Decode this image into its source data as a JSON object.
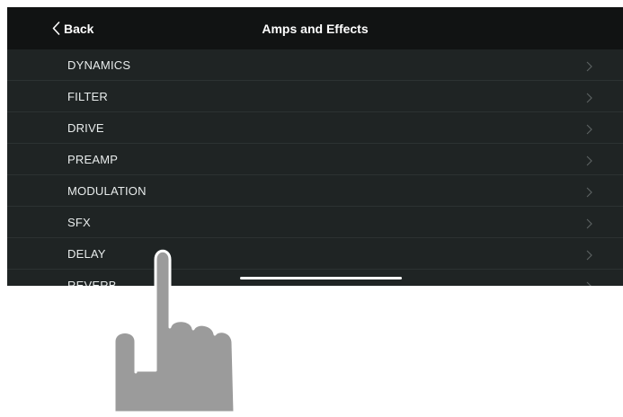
{
  "navbar": {
    "back_label": "Back",
    "title": "Amps and Effects"
  },
  "list": {
    "items": [
      {
        "label": "DYNAMICS"
      },
      {
        "label": "FILTER"
      },
      {
        "label": "DRIVE"
      },
      {
        "label": "PREAMP"
      },
      {
        "label": "MODULATION"
      },
      {
        "label": "SFX"
      },
      {
        "label": "DELAY"
      },
      {
        "label": "REVERB"
      }
    ]
  },
  "icons": {
    "back": "chevron-left-icon",
    "row": "chevron-right-icon",
    "gesture": "hand-pointer-icon"
  },
  "colors": {
    "navbar_bg": "#111313",
    "list_bg": "#1f2424",
    "text": "#ffffff",
    "chevron": "#5a6060",
    "hand": "#9a9a9a"
  }
}
